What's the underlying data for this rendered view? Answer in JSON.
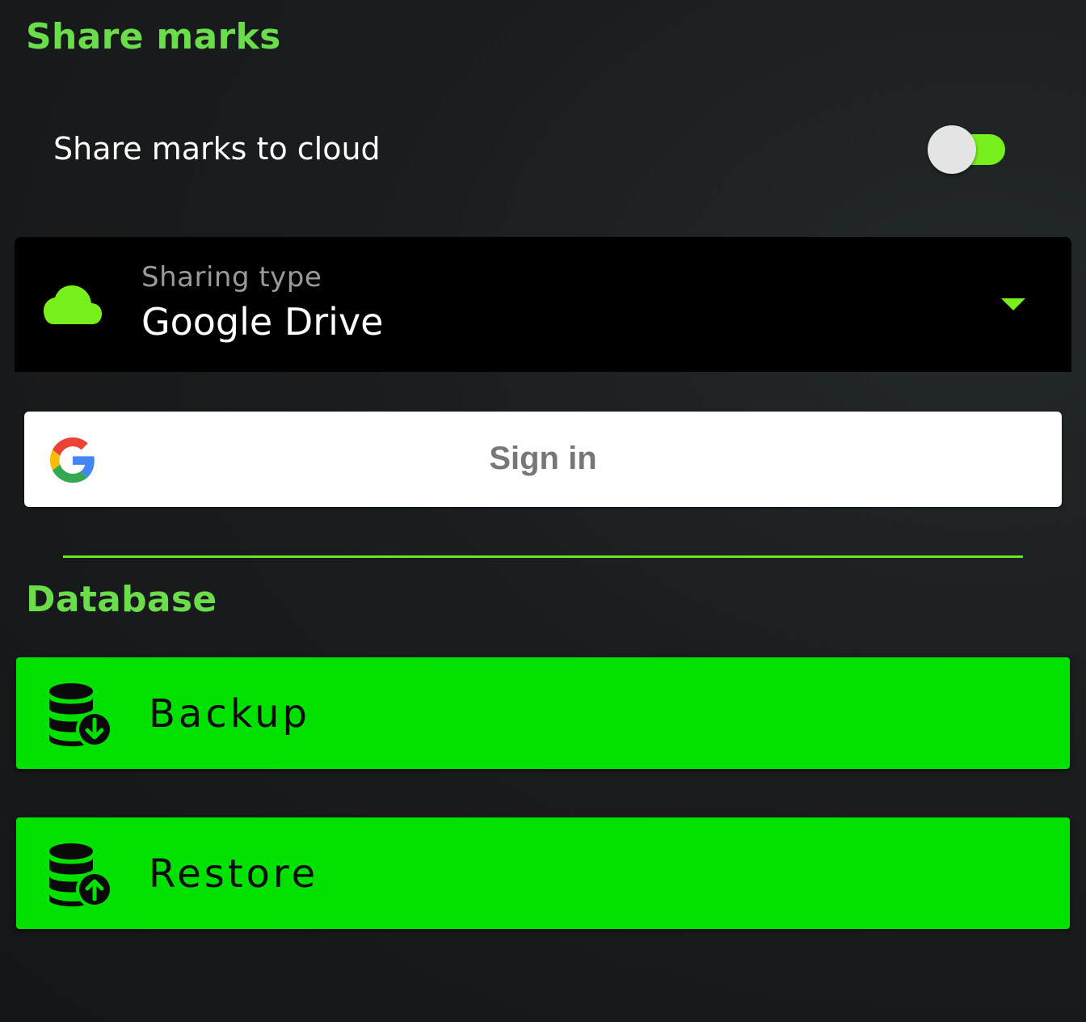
{
  "share_section": {
    "title": "Share marks",
    "toggle": {
      "label": "Share marks to cloud",
      "on": true
    },
    "sharing_type": {
      "label": "Sharing type",
      "value": "Google Drive",
      "icon": "cloud-icon"
    },
    "sign_in": {
      "label": "Sign in",
      "icon": "google-icon"
    }
  },
  "database_section": {
    "title": "Database",
    "backup": {
      "label": "Backup",
      "icon": "database-download-icon"
    },
    "restore": {
      "label": "Restore",
      "icon": "database-upload-icon"
    }
  },
  "colors": {
    "background": "#1a1d1f",
    "accent": "#6bdc4a",
    "switch_track": "#78f01c",
    "button": "#00e100",
    "dropdown_bg": "#000000"
  }
}
